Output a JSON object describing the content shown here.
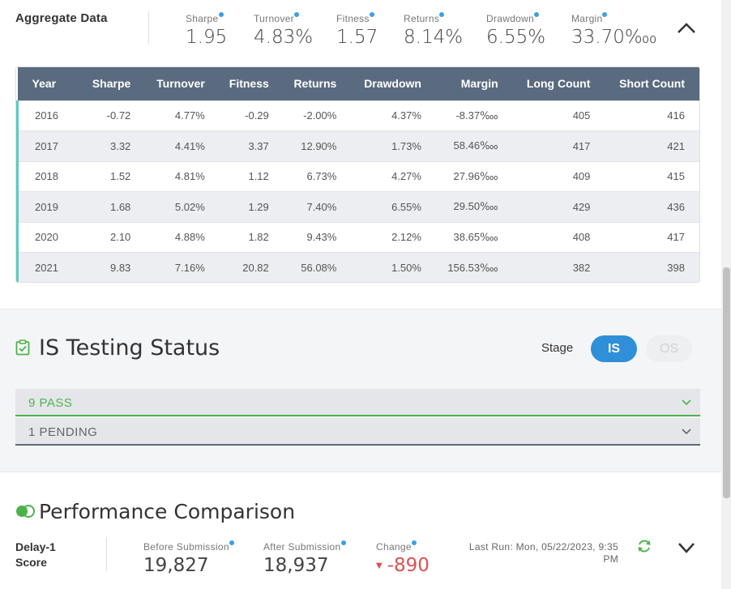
{
  "aggregate": {
    "title": "Aggregate Data",
    "metrics": [
      {
        "label": "Sharpe",
        "value": "1.95"
      },
      {
        "label": "Turnover",
        "value": "4.83%"
      },
      {
        "label": "Fitness",
        "value": "1.57"
      },
      {
        "label": "Returns",
        "value": "8.14%"
      },
      {
        "label": "Drawdown",
        "value": "6.55%"
      },
      {
        "label": "Margin",
        "value": "33.70‱"
      }
    ],
    "collapse_icon": "chevron-up-icon"
  },
  "table": {
    "headers": [
      "Year",
      "Sharpe",
      "Turnover",
      "Fitness",
      "Returns",
      "Drawdown",
      "Margin",
      "Long Count",
      "Short Count"
    ],
    "rows": [
      [
        "2016",
        "-0.72",
        "4.77%",
        "-0.29",
        "-2.00%",
        "4.37%",
        "-8.37‱",
        "405",
        "416"
      ],
      [
        "2017",
        "3.32",
        "4.41%",
        "3.37",
        "12.90%",
        "1.73%",
        "58.46‱",
        "417",
        "421"
      ],
      [
        "2018",
        "1.52",
        "4.81%",
        "1.12",
        "6.73%",
        "4.27%",
        "27.96‱",
        "409",
        "415"
      ],
      [
        "2019",
        "1.68",
        "5.02%",
        "1.29",
        "7.40%",
        "6.55%",
        "29.50‱",
        "429",
        "436"
      ],
      [
        "2020",
        "2.10",
        "4.88%",
        "1.82",
        "9.43%",
        "2.12%",
        "38.65‱",
        "408",
        "417"
      ],
      [
        "2021",
        "9.83",
        "7.16%",
        "20.82",
        "56.08%",
        "1.50%",
        "156.53‱",
        "382",
        "398"
      ]
    ]
  },
  "is_testing": {
    "title": "IS Testing Status",
    "stage_label": "Stage",
    "stage_options": [
      "IS",
      "OS"
    ],
    "pass_label": "9 PASS",
    "pending_label": "1 PENDING",
    "colors": {
      "pass": "#4cb34a",
      "active_stage": "#2f8fd8"
    }
  },
  "performance": {
    "title": "Performance Comparison",
    "score_label": "Delay-1 Score",
    "before_label": "Before Submission",
    "before_value": "19,827",
    "after_label": "After Submission",
    "after_value": "18,937",
    "change_label": "Change",
    "change_value": "-890",
    "last_run": "Last Run: Mon, 05/22/2023, 9:35 PM"
  }
}
